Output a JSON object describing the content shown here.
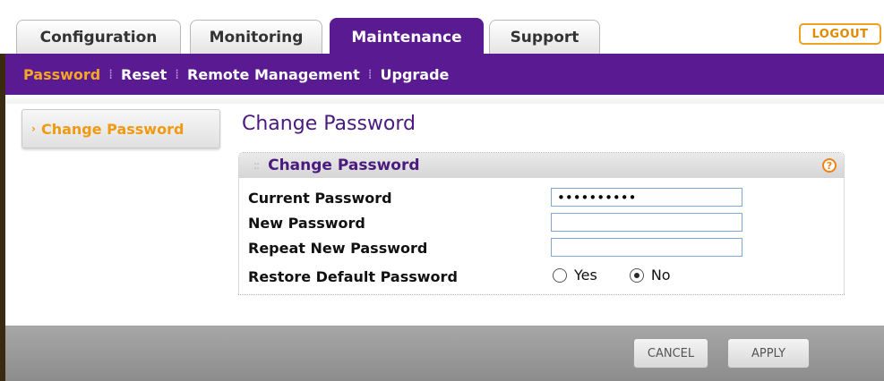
{
  "tabs": [
    {
      "label": "Configuration",
      "active": false
    },
    {
      "label": "Monitoring",
      "active": false
    },
    {
      "label": "Maintenance",
      "active": true
    },
    {
      "label": "Support",
      "active": false
    }
  ],
  "logout_label": "LOGOUT",
  "subnav": {
    "items": [
      {
        "label": "Password",
        "active": true
      },
      {
        "label": "Reset",
        "active": false
      },
      {
        "label": "Remote Management",
        "active": false
      },
      {
        "label": "Upgrade",
        "active": false
      }
    ]
  },
  "sidebar": {
    "label": "Change Password",
    "icon": "chevron-right-icon"
  },
  "page_title": "Change Password",
  "panel": {
    "title": "Change Password",
    "help_icon": "help-icon",
    "help_glyph": "?",
    "fields": {
      "current_password": {
        "label": "Current Password",
        "value": "••••••••••"
      },
      "new_password": {
        "label": "New Password",
        "value": ""
      },
      "repeat_password": {
        "label": "Repeat New Password",
        "value": ""
      }
    },
    "restore": {
      "label": "Restore Default Password",
      "options": [
        {
          "label": "Yes",
          "checked": false
        },
        {
          "label": "No",
          "checked": true
        }
      ]
    }
  },
  "buttons": {
    "cancel": "CANCEL",
    "apply": "APPLY"
  },
  "colors": {
    "brand_purple": "#5a1a92",
    "accent_orange": "#f5a623",
    "title_purple": "#4a1a7e"
  }
}
